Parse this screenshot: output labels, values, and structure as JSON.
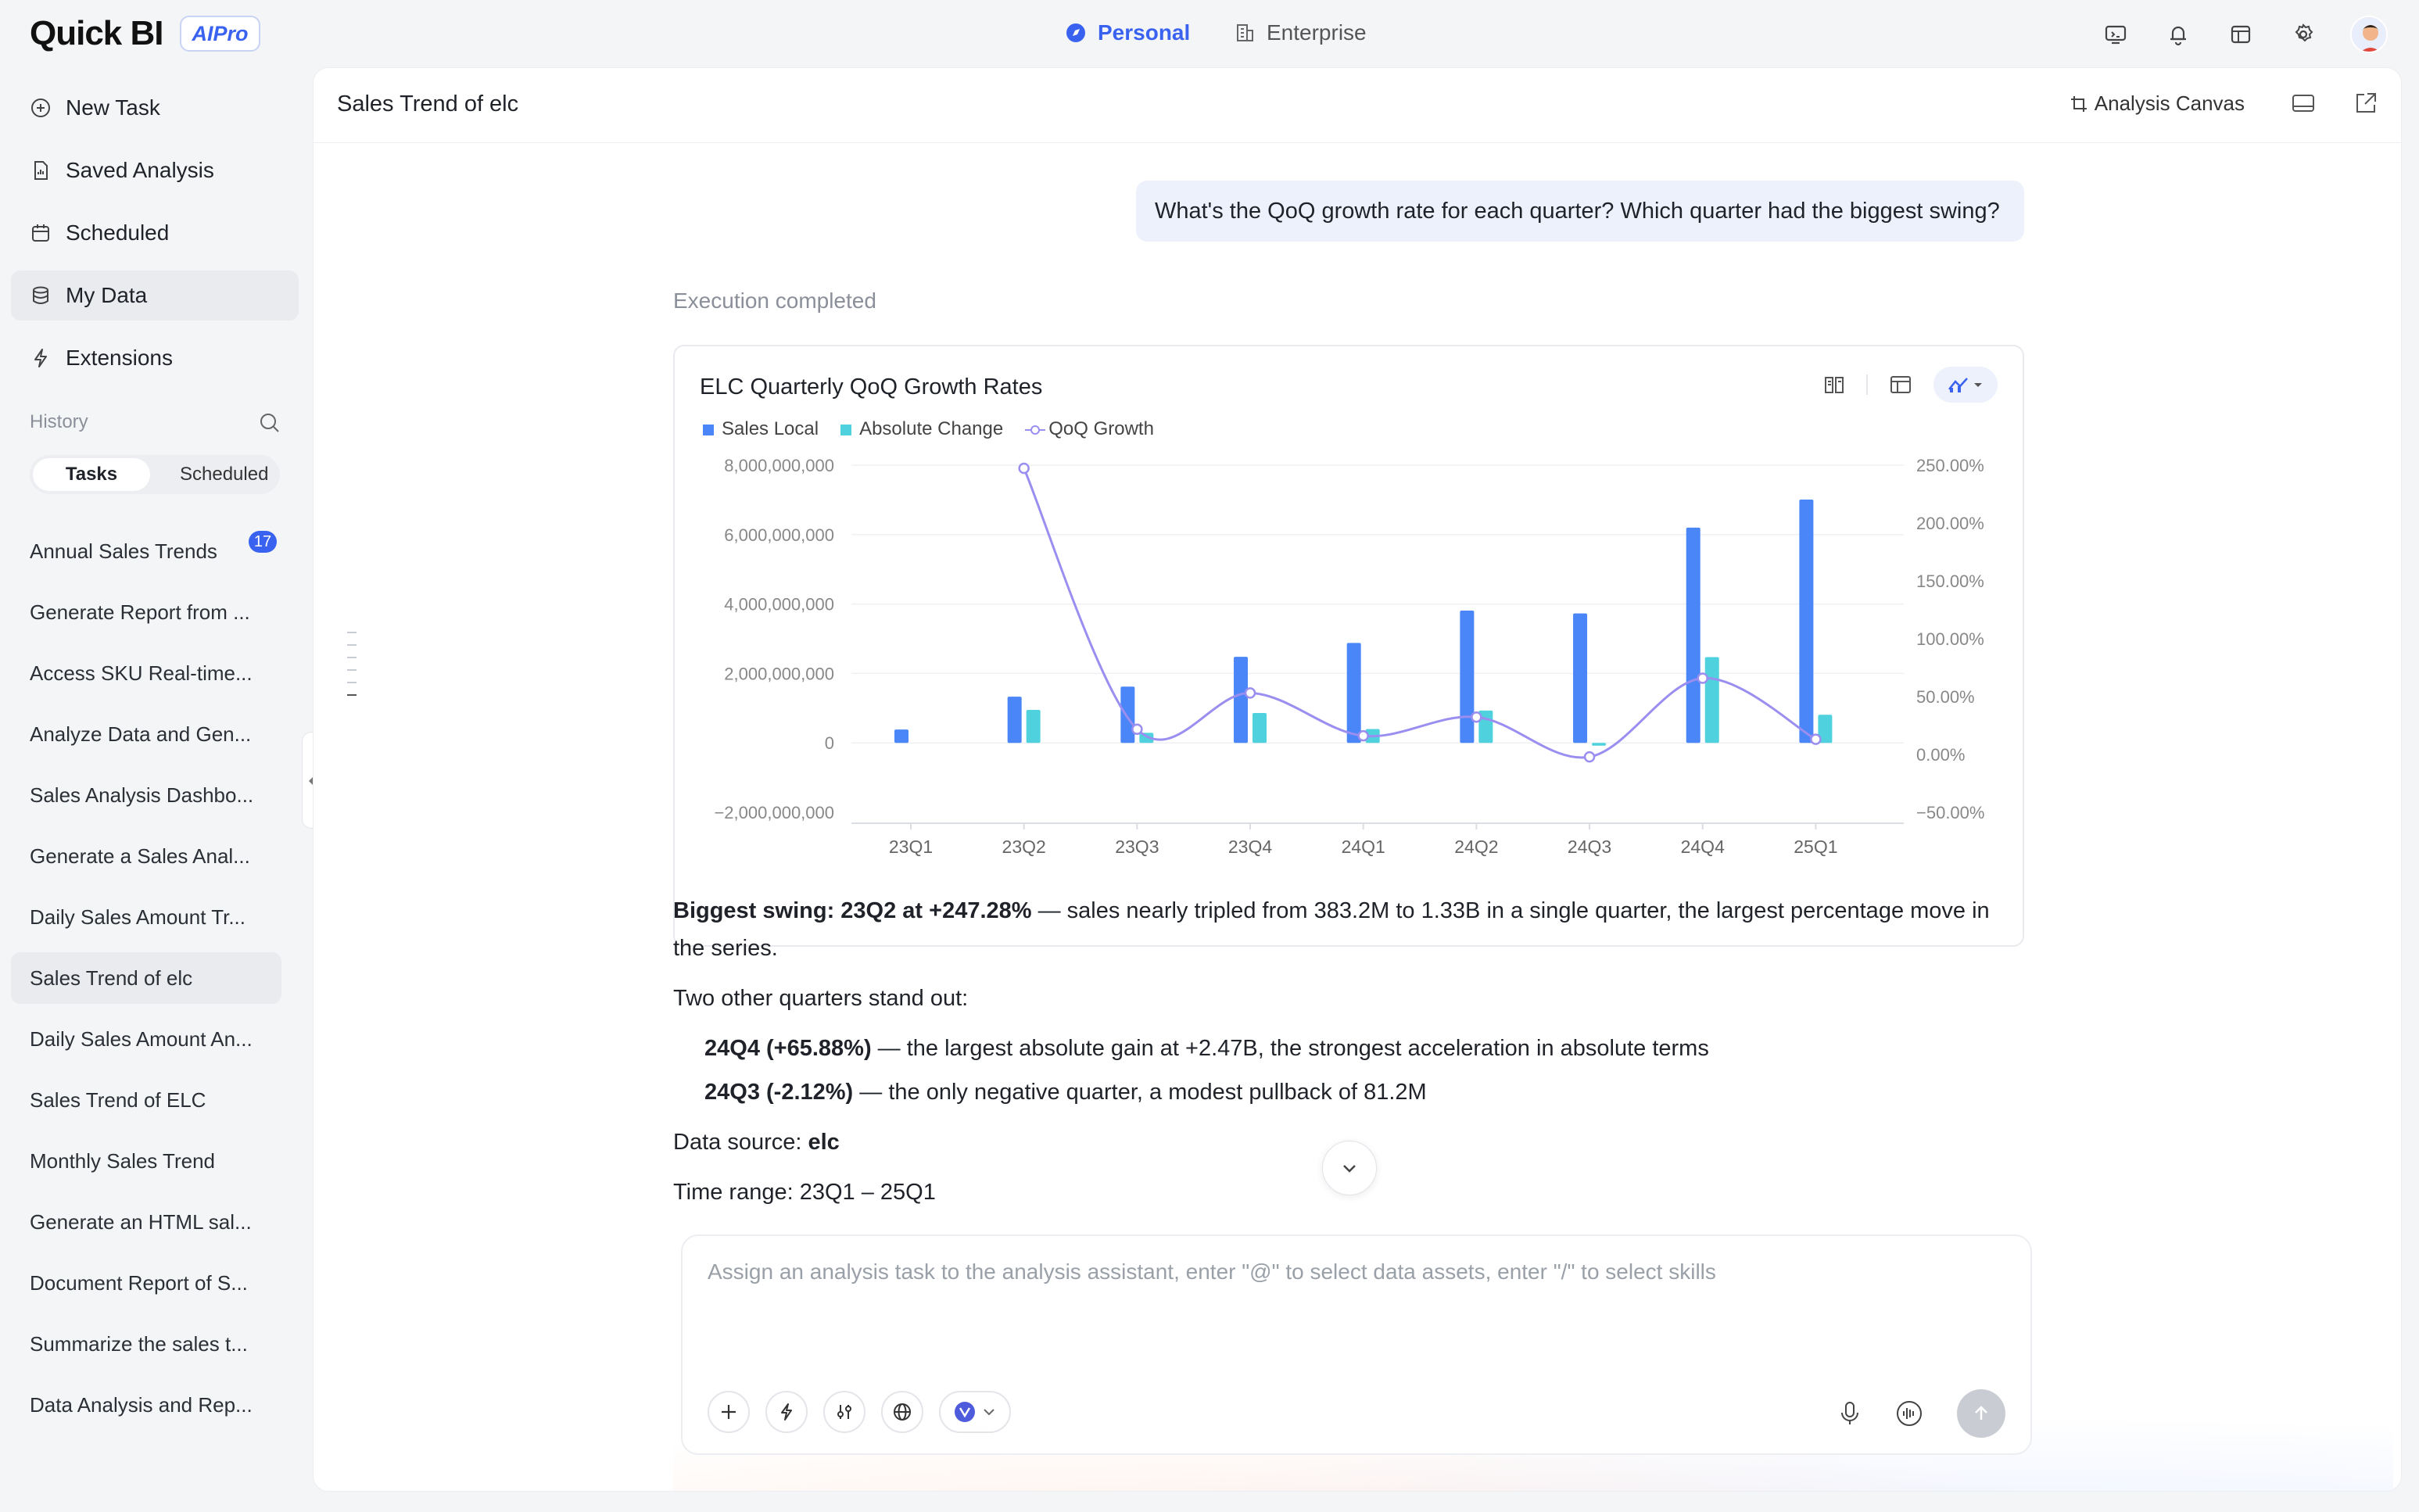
{
  "app": {
    "logo": "Quick BI",
    "badge": "AIPro"
  },
  "topnav": {
    "tabs": [
      {
        "label": "Personal",
        "active": true
      },
      {
        "label": "Enterprise",
        "active": false
      }
    ]
  },
  "sidebar": {
    "nav": [
      {
        "label": "New Task",
        "icon": "plus-circle-icon"
      },
      {
        "label": "Saved Analysis",
        "icon": "document-icon"
      },
      {
        "label": "Scheduled",
        "icon": "calendar-icon"
      },
      {
        "label": "My Data",
        "icon": "database-icon",
        "active": true
      },
      {
        "label": "Extensions",
        "icon": "lightning-icon"
      }
    ],
    "history_label": "History",
    "segment": {
      "tasks": "Tasks",
      "scheduled": "Scheduled",
      "scheduled_count": "17"
    },
    "history": [
      "Annual Sales Trends",
      "Generate Report from ...",
      "Access SKU Real-time...",
      "Analyze Data and Gen...",
      "Sales Analysis Dashbo...",
      "Generate a Sales Anal...",
      "Daily Sales Amount Tr...",
      "Sales Trend of elc",
      "Daily Sales Amount An...",
      "Sales Trend of ELC",
      "Monthly Sales Trend",
      "Generate an HTML sal...",
      "Document Report of S...",
      "Summarize the sales t...",
      "Data Analysis and Rep..."
    ],
    "active_history_index": 7
  },
  "main": {
    "title": "Sales Trend of elc",
    "canvas_button": "Analysis Canvas",
    "user_question": "What's the QoQ growth rate for each quarter? Which quarter had the biggest swing?",
    "status": "Execution completed",
    "answer": {
      "p1_bold": "Biggest swing: 23Q2 at +247.28%",
      "p1_rest": " — sales nearly tripled from 383.2M to 1.33B in a single quarter, the largest percentage move in",
      "p1_cont": "the series.",
      "p2": "Two other quarters stand out:",
      "b1_bold": "24Q4 (+65.88%)",
      "b1_rest": " — the largest absolute gain at +2.47B, the strongest acceleration in absolute terms",
      "b2_bold": "24Q3 (-2.12%)",
      "b2_rest": " — the only negative quarter, a modest pullback of 81.2M",
      "src_label": "Data source: ",
      "src_value": "elc",
      "time_range": "Time range: 23Q1 – 25Q1"
    },
    "input_placeholder": "Assign an analysis task to the analysis assistant, enter \"@\" to select data assets, enter \"/\" to select skills"
  },
  "chart_data": {
    "type": "bar",
    "title": "ELC Quarterly QoQ Growth Rates",
    "categories": [
      "23Q1",
      "23Q2",
      "23Q3",
      "23Q4",
      "24Q1",
      "24Q2",
      "24Q3",
      "24Q4",
      "25Q1"
    ],
    "series": [
      {
        "name": "Sales Local",
        "type": "bar",
        "axis": "left",
        "color": "#4a86f7",
        "values": [
          383200000,
          1330000000,
          1620000000,
          2480000000,
          2880000000,
          3810000000,
          3730000000,
          6200000000,
          7010000000
        ]
      },
      {
        "name": "Absolute Change",
        "type": "bar",
        "axis": "left",
        "color": "#4fd2de",
        "values": [
          null,
          950000000,
          290000000,
          860000000,
          400000000,
          930000000,
          -81200000,
          2470000000,
          810000000
        ]
      },
      {
        "name": "QoQ Growth",
        "type": "line",
        "axis": "right",
        "color": "#9a8ef0",
        "values": [
          null,
          247.28,
          21.8,
          53.1,
          16.1,
          32.3,
          -2.12,
          65.88,
          13.1
        ]
      }
    ],
    "y_left": {
      "ticks": [
        "8,000,000,000",
        "6,000,000,000",
        "4,000,000,000",
        "2,000,000,000",
        "0",
        "−2,000,000,000"
      ],
      "min": -2000000000,
      "max": 8000000000
    },
    "y_right": {
      "ticks": [
        "250.00%",
        "200.00%",
        "150.00%",
        "100.00%",
        "50.00%",
        "0.00%",
        "−50.00%"
      ],
      "min": -50,
      "max": 250
    },
    "grid": true,
    "legend": "top-left"
  }
}
